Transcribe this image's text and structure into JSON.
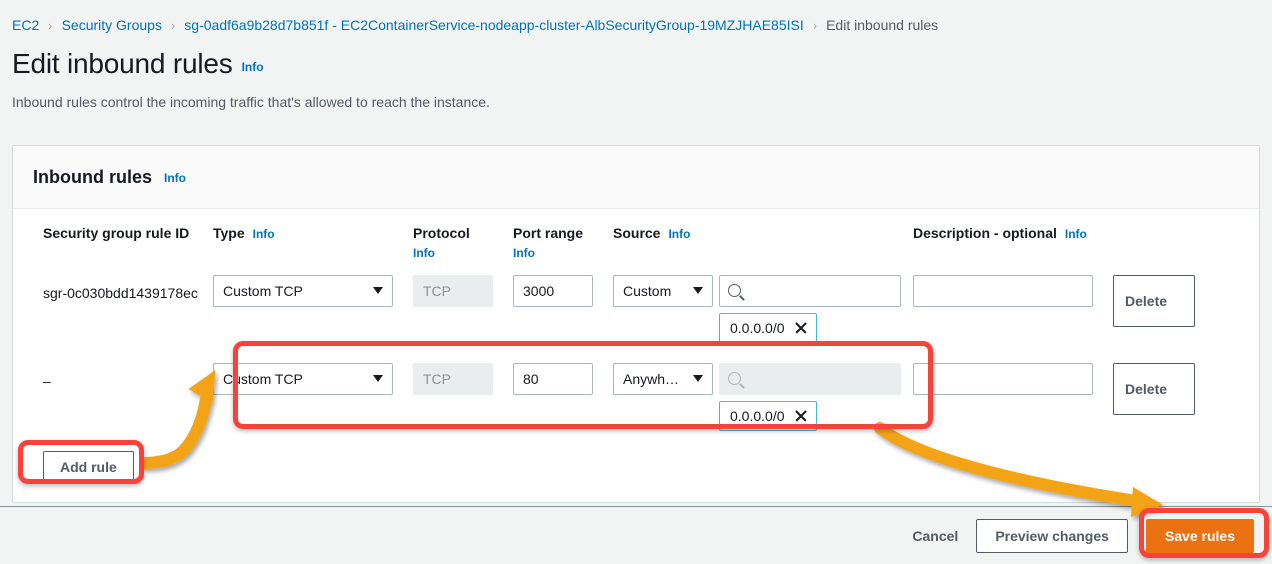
{
  "breadcrumb": {
    "items": [
      {
        "label": "EC2",
        "current": false
      },
      {
        "label": "Security Groups",
        "current": false
      },
      {
        "label": "sg-0adf6a9b28d7b851f - EC2ContainerService-nodeapp-cluster-AlbSecurityGroup-19MZJHAE85ISI",
        "current": false
      },
      {
        "label": "Edit inbound rules",
        "current": true
      }
    ],
    "separator": "›"
  },
  "page": {
    "title": "Edit inbound rules",
    "info_label": "Info",
    "description": "Inbound rules control the incoming traffic that's allowed to reach the instance."
  },
  "card": {
    "title": "Inbound rules",
    "info_label": "Info"
  },
  "table": {
    "headers": {
      "rule_id": "Security group rule ID",
      "type": "Type",
      "type_info": "Info",
      "protocol": "Protocol",
      "protocol_info": "Info",
      "port_range": "Port range",
      "port_info": "Info",
      "source": "Source",
      "source_info": "Info",
      "description": "Description - optional",
      "description_info": "Info"
    },
    "rows": [
      {
        "rule_id": "sgr-0c030bdd1439178ec",
        "type": "Custom TCP",
        "protocol": "TCP",
        "port_range": "3000",
        "source_type": "Custom",
        "source_search_value": "",
        "source_search_disabled": false,
        "source_token": "0.0.0.0/0",
        "description": "",
        "delete_label": "Delete"
      },
      {
        "rule_id": "–",
        "type": "Custom TCP",
        "protocol": "TCP",
        "port_range": "80",
        "source_type": "Anywh…",
        "source_search_value": "",
        "source_search_disabled": true,
        "source_token": "0.0.0.0/0",
        "description": "",
        "delete_label": "Delete"
      }
    ],
    "add_rule_label": "Add rule"
  },
  "footer": {
    "cancel_label": "Cancel",
    "preview_label": "Preview changes",
    "save_label": "Save rules"
  },
  "colors": {
    "accent_blue": "#0073bb",
    "save_orange": "#ec7211",
    "highlight_red": "#f9423a",
    "arrow_orange": "#f2a317",
    "page_background": "#f2f3f3",
    "token_border": "#44b9d6"
  },
  "icons": {
    "search": "search-icon",
    "caret": "chevron-down-icon",
    "close": "close-icon"
  }
}
